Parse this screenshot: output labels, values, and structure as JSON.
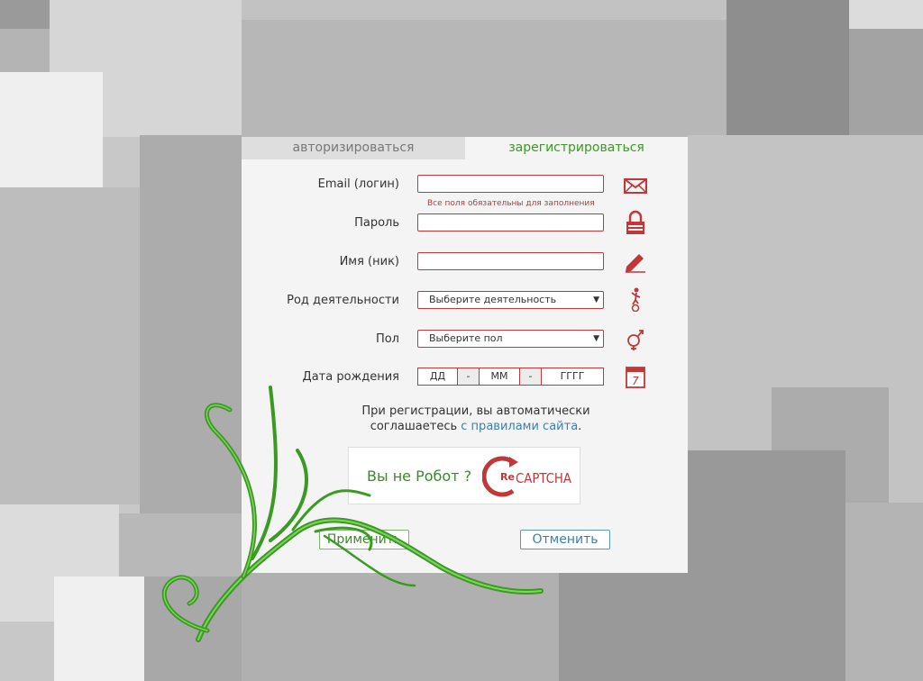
{
  "tabs": {
    "login": "авторизироваться",
    "register": "зарегистрироваться"
  },
  "form": {
    "email_label": "Email (логин)",
    "required_hint": "Все поля обязательны для заполнения",
    "password_label": "Пароль",
    "name_label": "Имя (ник)",
    "activity_label": "Род деятельности",
    "activity_selected": "Выберите деятельность",
    "gender_label": "Пол",
    "gender_selected": "Выберите пол",
    "birthdate_label": "Дата рождения",
    "day_placeholder": "ДД",
    "month_placeholder": "ММ",
    "year_placeholder": "ГГГГ",
    "date_separator": "-"
  },
  "notice": {
    "line1": "При регистрации, вы автоматически",
    "line2_prefix": "соглашаетесь ",
    "link": "с правилами сайта",
    "line2_suffix": "."
  },
  "captcha": {
    "text": "Вы не Робот ?",
    "logo_re": "Re",
    "logo_captcha": "CAPTCHA"
  },
  "buttons": {
    "apply": "Применить",
    "cancel": "Отменить"
  },
  "calendar_day": "7",
  "icons": [
    "envelope-icon",
    "lock-icon",
    "pencil-icon",
    "unicyclist-icon",
    "gender-icon",
    "calendar-icon"
  ],
  "colors": {
    "accent_red": "#c23737",
    "accent_green": "#3a9a22",
    "link_blue": "#3a7fb0"
  }
}
